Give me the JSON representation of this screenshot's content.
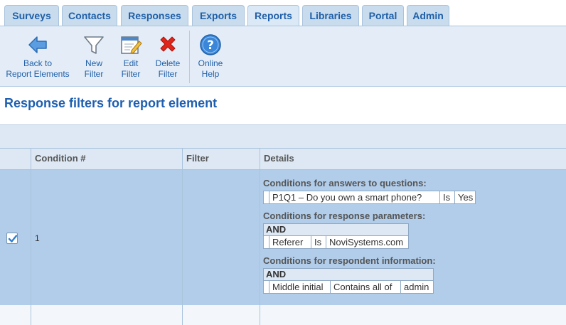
{
  "tabs": [
    {
      "label": "Surveys",
      "active": false
    },
    {
      "label": "Contacts",
      "active": false
    },
    {
      "label": "Responses",
      "active": false
    },
    {
      "label": "Exports",
      "active": false
    },
    {
      "label": "Reports",
      "active": true
    },
    {
      "label": "Libraries",
      "active": false
    },
    {
      "label": "Portal",
      "active": false
    },
    {
      "label": "Admin",
      "active": false
    }
  ],
  "toolbar": {
    "back": {
      "line1": "Back to",
      "line2": "Report Elements",
      "icon": "back-arrow-icon"
    },
    "new": {
      "line1": "New",
      "line2": "Filter",
      "icon": "funnel-icon"
    },
    "edit": {
      "line1": "Edit",
      "line2": "Filter",
      "icon": "edit-note-icon"
    },
    "delete": {
      "line1": "Delete",
      "line2": "Filter",
      "icon": "red-x-icon"
    },
    "help": {
      "line1": "Online",
      "line2": "Help",
      "icon": "help-question-icon"
    }
  },
  "page": {
    "title": "Response filters for report element"
  },
  "grid": {
    "columns": [
      "Condition #",
      "Filter",
      "Details"
    ],
    "rows": [
      {
        "checked": true,
        "condition_number": "1",
        "filter": "",
        "details": {
          "questions": {
            "heading": "Conditions for answers to questions:",
            "cells": [
              "P1Q1 – Do you own a smart phone?",
              "Is",
              "Yes"
            ]
          },
          "parameters": {
            "heading": "Conditions for response parameters:",
            "operator": "AND",
            "cells": [
              "Referer",
              "Is",
              "NoviSystems.com"
            ]
          },
          "respondent": {
            "heading": "Conditions for respondent information:",
            "operator": "AND",
            "cells": [
              "Middle initial",
              "Contains all of",
              "admin"
            ]
          }
        }
      }
    ]
  },
  "colors": {
    "accent": "#1e5fb0",
    "selected_row": "#b2cdea",
    "toolbar_bg": "#e4edf7"
  }
}
